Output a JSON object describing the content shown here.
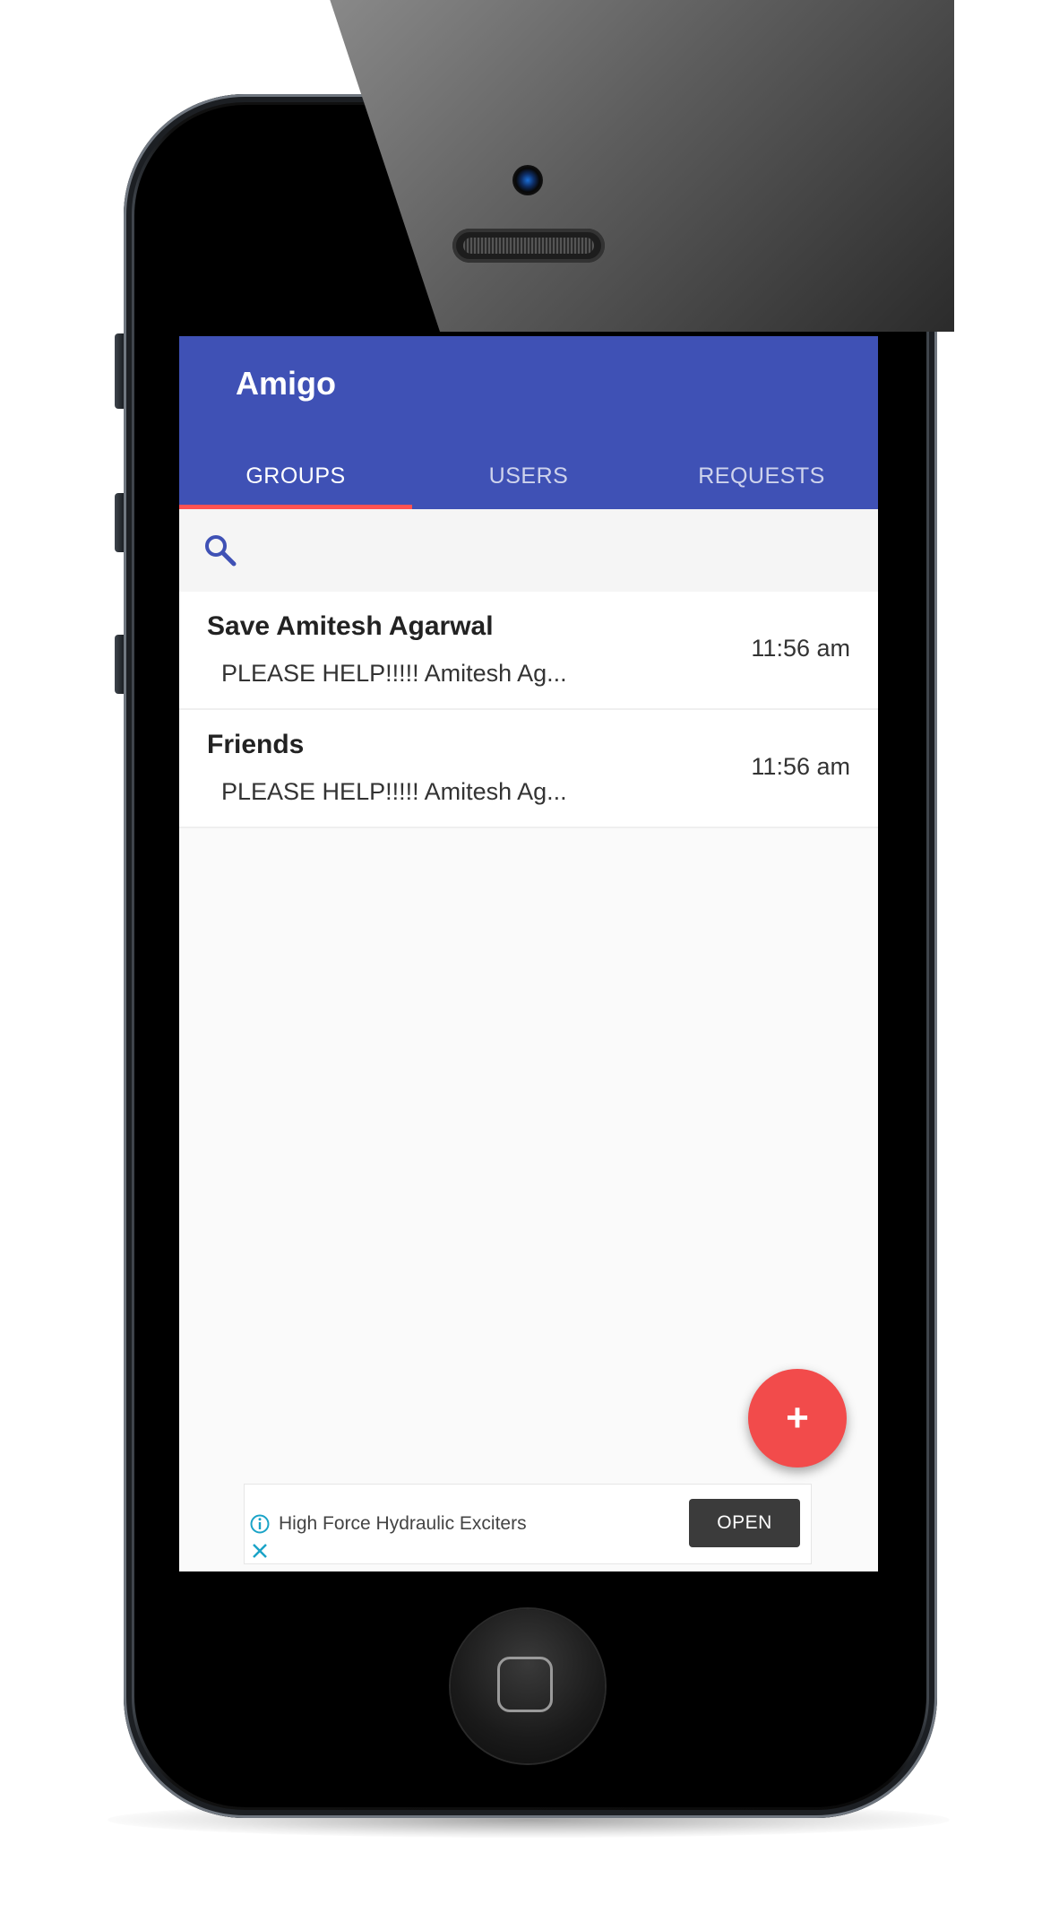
{
  "app": {
    "title": "Amigo",
    "accent_color": "#3f51b5",
    "indicator_color": "#ff5252",
    "fab_color": "#f24b4b"
  },
  "tabs": [
    {
      "label": "GROUPS",
      "active": true
    },
    {
      "label": "USERS",
      "active": false
    },
    {
      "label": "REQUESTS",
      "active": false
    }
  ],
  "search": {
    "icon": "search-icon"
  },
  "chats": [
    {
      "name": "Save Amitesh Agarwal",
      "preview": "PLEASE HELP!!!!! Amitesh Ag...",
      "time": "11:56 am"
    },
    {
      "name": "Friends",
      "preview": "PLEASE HELP!!!!! Amitesh Ag...",
      "time": "11:56 am"
    }
  ],
  "fab": {
    "label": "+",
    "icon": "plus-icon"
  },
  "ad": {
    "text": "High Force Hydraulic Exciters",
    "button_label": "OPEN",
    "info_icon": "info-icon",
    "close_icon": "close-icon"
  }
}
